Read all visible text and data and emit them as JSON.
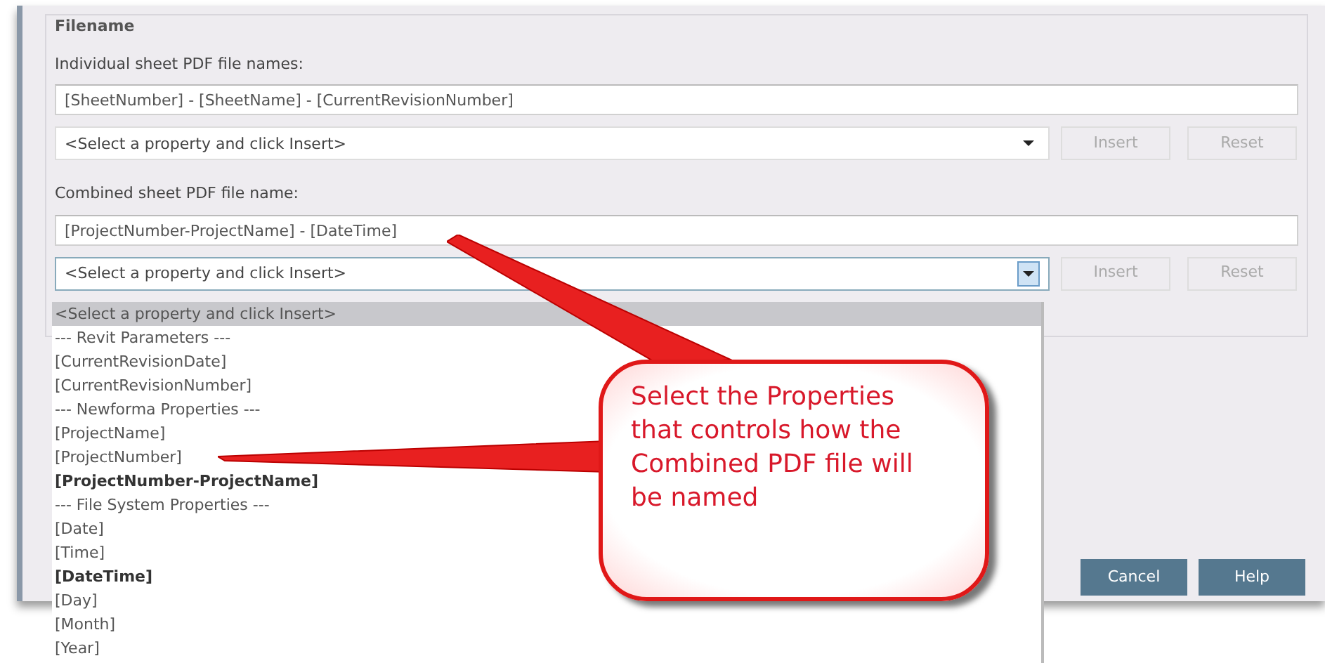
{
  "fieldset": {
    "legend": "Filename"
  },
  "individual": {
    "label": "Individual sheet PDF file names:",
    "value": "[SheetNumber] - [SheetName] - [CurrentRevisionNumber]",
    "select": "<Select a property and click Insert>",
    "expanded": false,
    "buttons": [
      {
        "label": "Insert",
        "disabled": true
      },
      {
        "label": "Reset",
        "disabled": true
      }
    ]
  },
  "combined": {
    "label": "Combined sheet PDF file name:",
    "value": "[ProjectNumber-ProjectName] - [DateTime]",
    "select": "<Select a property and click Insert>",
    "expanded": true,
    "buttons": [
      {
        "label": "Insert",
        "disabled": true
      },
      {
        "label": "Reset",
        "disabled": true
      }
    ]
  },
  "dropdown_options": [
    {
      "label": "<Select a property and click Insert>",
      "selected": true,
      "bold": false
    },
    {
      "label": "--- Revit Parameters ---",
      "selected": false,
      "bold": false
    },
    {
      "label": "[CurrentRevisionDate]",
      "selected": false,
      "bold": false
    },
    {
      "label": "[CurrentRevisionNumber]",
      "selected": false,
      "bold": false
    },
    {
      "label": "--- Newforma Properties ---",
      "selected": false,
      "bold": false
    },
    {
      "label": "[ProjectName]",
      "selected": false,
      "bold": false
    },
    {
      "label": "[ProjectNumber]",
      "selected": false,
      "bold": false
    },
    {
      "label": "[ProjectNumber-ProjectName]",
      "selected": false,
      "bold": true
    },
    {
      "label": "--- File System Properties ---",
      "selected": false,
      "bold": false
    },
    {
      "label": "[Date]",
      "selected": false,
      "bold": false
    },
    {
      "label": "[Time]",
      "selected": false,
      "bold": false
    },
    {
      "label": "[DateTime]",
      "selected": false,
      "bold": true
    },
    {
      "label": "[Day]",
      "selected": false,
      "bold": false
    },
    {
      "label": "[Month]",
      "selected": false,
      "bold": false
    },
    {
      "label": "[Year]",
      "selected": false,
      "bold": false
    }
  ],
  "footer_buttons": [
    "Cancel",
    "Help"
  ],
  "callout": {
    "text": "Select the Properties that controls how the Combined PDF file will be named"
  }
}
